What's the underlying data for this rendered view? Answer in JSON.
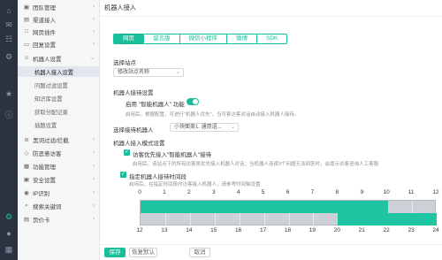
{
  "colors": {
    "accent": "#19be9b",
    "sidebar_bg": "#2b3340",
    "nav_bg": "#f5f6f8",
    "timeline_on": "#1fc4a2",
    "timeline_off": "#cdd1d7"
  },
  "rail": {
    "icons": [
      "home-icon",
      "chat-icon",
      "contacts-icon",
      "settings-icon",
      "star-icon",
      "info-icon",
      "gear-icon",
      "user-icon",
      "grid-icon"
    ]
  },
  "nav": {
    "items": [
      {
        "label": "团队管理",
        "icon": "team-icon"
      },
      {
        "label": "渠道接入",
        "icon": "channel-icon"
      },
      {
        "label": "网页插件",
        "icon": "web-icon"
      },
      {
        "label": "回复设置",
        "icon": "reply-icon"
      },
      {
        "label": "机器人设置",
        "icon": "robot-icon"
      }
    ],
    "subitems": [
      "机器人接入设置",
      "问题过滤设置",
      "知识库设置",
      "获取分配记录",
      "插题设置"
    ],
    "items2": [
      {
        "label": "黑词过滤/拦截",
        "icon": "filter-icon"
      },
      {
        "label": "防恶意访客",
        "icon": "shield-icon"
      },
      {
        "label": "功能管理",
        "icon": "function-icon"
      },
      {
        "label": "安全设置",
        "icon": "lock-icon"
      },
      {
        "label": "IP识别",
        "icon": "ip-icon"
      },
      {
        "label": "搜索关键词",
        "icon": "search-icon"
      },
      {
        "label": "页价卡",
        "icon": "card-icon"
      }
    ]
  },
  "main": {
    "breadcrumb": "机器人接入",
    "tabs": [
      "网页",
      "留言版",
      "微信小程序",
      "微博",
      "SDK"
    ],
    "active_tab": 0,
    "site_label": "选择站点",
    "site_value": "修改站点名称",
    "robot_section": "机器人接待设置",
    "enable_label": "启用",
    "enable_highlight": "\"智能机器人\"",
    "enable_suffix": "功能",
    "enable_hint": "启用后，根据配置，可进行\"机器人优先\"，当可客访客对话自动接入机器人接待。",
    "choose_label": "选择接待机器人",
    "robot_value": "小快面美1. 通用语...",
    "access_section": "机器人接入模式设置",
    "opt1_label": "访客优先接入\"智能机器人\"接待",
    "opt1_hint": "启用后，该站点下的所有访客将优先接入机器人对话；当机器人连续3个问题无法回答时，会提示访客咨询人工客服",
    "opt2_label": "指定机器人接待时间段",
    "opt2_hint": "启用后，在指定时间段内访客接入机器人，请参考时间轴设置"
  },
  "timeline": {
    "top_labels": [
      "0",
      "1",
      "2",
      "3",
      "4",
      "5",
      "6",
      "7",
      "8",
      "9",
      "10",
      "11",
      "12"
    ],
    "bottom_labels": [
      "12",
      "13",
      "14",
      "15",
      "16",
      "17",
      "18",
      "19",
      "20",
      "21",
      "22",
      "23",
      "24"
    ],
    "active_top_hours": [
      0,
      1,
      2,
      3,
      4,
      5,
      6,
      7,
      8,
      9
    ],
    "active_bottom_hours": [
      20,
      21,
      22,
      23
    ]
  },
  "footer": {
    "save": "保存",
    "cancel": "恢复默认",
    "reset": "取消"
  }
}
